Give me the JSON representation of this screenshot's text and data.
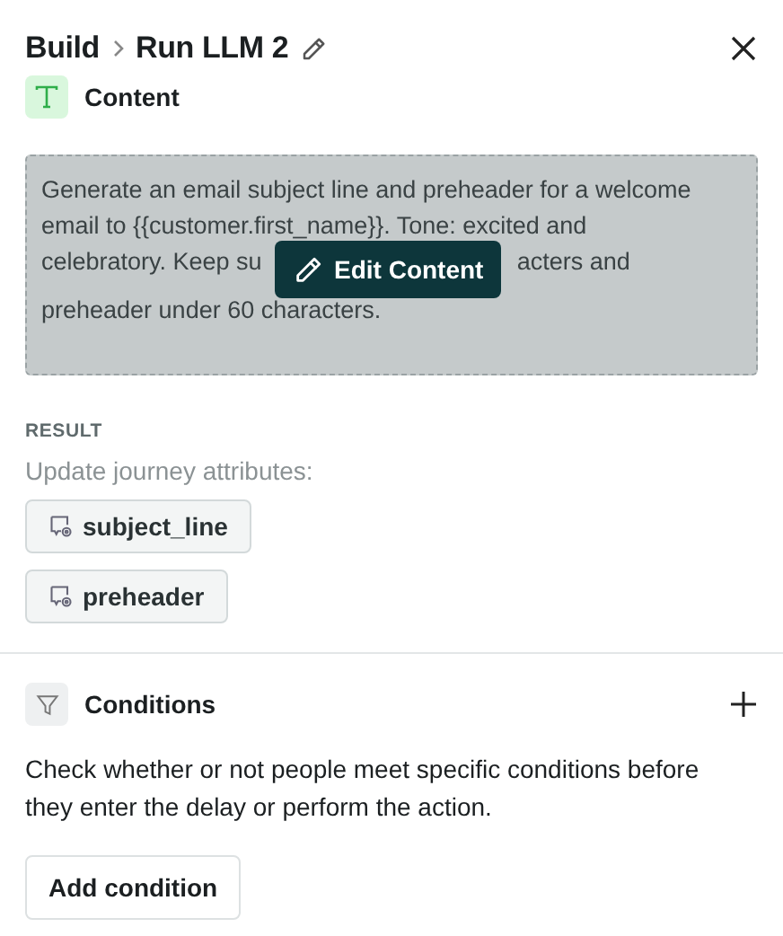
{
  "header": {
    "breadcrumb": [
      "Build",
      "Run LLM 2"
    ]
  },
  "content": {
    "label": "Content",
    "lines": [
      {
        "left": "Generate an email subject line and preheader for a welcome"
      },
      {
        "left": "email to {{customer.first_name}}. Tone: excited and"
      },
      {
        "left": "celebratory. Keep su",
        "right": "acters and"
      },
      {
        "left": "preheader under 60 characters."
      }
    ],
    "edit_button": "Edit Content"
  },
  "result": {
    "heading": "RESULT",
    "description": "Update journey attributes:",
    "attributes": [
      "subject_line",
      "preheader"
    ]
  },
  "conditions": {
    "title": "Conditions",
    "description": "Check whether or not people meet specific conditions before they enter the delay or perform the action.",
    "button": "Add condition"
  }
}
